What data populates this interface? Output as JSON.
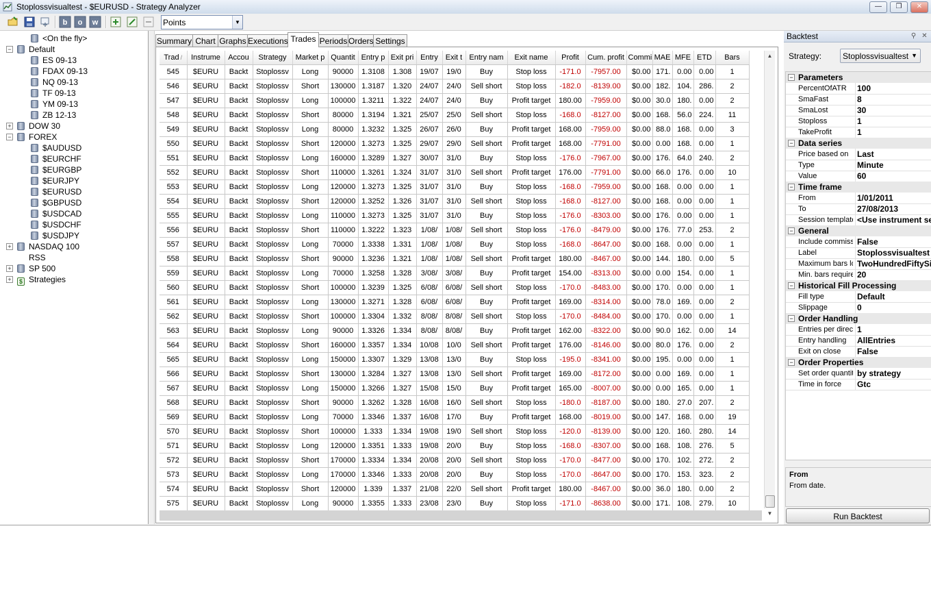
{
  "window": {
    "title": "Stoplossvisualtest - $EURUSD - Strategy Analyzer",
    "buttons": {
      "minimize": "—",
      "maximize": "❐",
      "close": "✕"
    }
  },
  "toolbar": {
    "display_unit": "Points",
    "icons": [
      "open-icon",
      "save-icon",
      "remove-icon",
      "bars-b-icon",
      "bars-o-icon",
      "bars-w-icon",
      "add-icon",
      "edit-icon",
      "minus-icon"
    ]
  },
  "tree": {
    "items": [
      {
        "label": "<On the fly>",
        "level": 1,
        "expander": ""
      },
      {
        "label": "Default",
        "level": 0,
        "expander": "−"
      },
      {
        "label": "ES 09-13",
        "level": 1,
        "expander": ""
      },
      {
        "label": "FDAX 09-13",
        "level": 1,
        "expander": ""
      },
      {
        "label": "NQ 09-13",
        "level": 1,
        "expander": ""
      },
      {
        "label": "TF 09-13",
        "level": 1,
        "expander": ""
      },
      {
        "label": "YM 09-13",
        "level": 1,
        "expander": ""
      },
      {
        "label": "ZB 12-13",
        "level": 1,
        "expander": ""
      },
      {
        "label": "DOW 30",
        "level": 0,
        "expander": "+"
      },
      {
        "label": "FOREX",
        "level": 0,
        "expander": "−"
      },
      {
        "label": "$AUDUSD",
        "level": 1,
        "expander": ""
      },
      {
        "label": "$EURCHF",
        "level": 1,
        "expander": ""
      },
      {
        "label": "$EURGBP",
        "level": 1,
        "expander": ""
      },
      {
        "label": "$EURJPY",
        "level": 1,
        "expander": ""
      },
      {
        "label": "$EURUSD",
        "level": 1,
        "expander": ""
      },
      {
        "label": "$GBPUSD",
        "level": 1,
        "expander": ""
      },
      {
        "label": "$USDCAD",
        "level": 1,
        "expander": ""
      },
      {
        "label": "$USDCHF",
        "level": 1,
        "expander": ""
      },
      {
        "label": "$USDJPY",
        "level": 1,
        "expander": ""
      },
      {
        "label": "NASDAQ 100",
        "level": 0,
        "expander": "+"
      },
      {
        "label": "RSS",
        "level": 0,
        "expander": ""
      },
      {
        "label": "SP 500",
        "level": 0,
        "expander": "+"
      },
      {
        "label": "Strategies",
        "level": 0,
        "expander": "+"
      }
    ]
  },
  "tabs": [
    "Summary",
    "Chart",
    "Graphs",
    "Executions",
    "Trades",
    "Periods",
    "Orders",
    "Settings"
  ],
  "active_tab": "Trades",
  "table": {
    "columns": [
      "Trad",
      "Instrume",
      "Accou",
      "Strategy",
      "Market p",
      "Quantit",
      "Entry p",
      "Exit pri",
      "Entry",
      "Exit t",
      "Entry nam",
      "Exit name",
      "Profit",
      "Cum. profit",
      "Commi",
      "MAE",
      "MFE",
      "ETD",
      "Bars"
    ],
    "sort_indicator": "/",
    "rows": [
      [
        "545",
        "$EURU",
        "Backt",
        "Stoplossv",
        "Long",
        "90000",
        "1.3108",
        "1.308",
        "19/07",
        "19/0",
        "Buy",
        "Stop loss",
        "-171.0",
        "-7957.00",
        "$0.00",
        "171.",
        "0.00",
        "0.00",
        "1"
      ],
      [
        "546",
        "$EURU",
        "Backt",
        "Stoplossv",
        "Short",
        "130000",
        "1.3187",
        "1.320",
        "24/07",
        "24/0",
        "Sell short",
        "Stop loss",
        "-182.0",
        "-8139.00",
        "$0.00",
        "182.",
        "104.",
        "286.",
        "2"
      ],
      [
        "547",
        "$EURU",
        "Backt",
        "Stoplossv",
        "Long",
        "100000",
        "1.3211",
        "1.322",
        "24/07",
        "24/0",
        "Buy",
        "Profit target",
        "180.00",
        "-7959.00",
        "$0.00",
        "30.0",
        "180.",
        "0.00",
        "2"
      ],
      [
        "548",
        "$EURU",
        "Backt",
        "Stoplossv",
        "Short",
        "80000",
        "1.3194",
        "1.321",
        "25/07",
        "25/0",
        "Sell short",
        "Stop loss",
        "-168.0",
        "-8127.00",
        "$0.00",
        "168.",
        "56.0",
        "224.",
        "11"
      ],
      [
        "549",
        "$EURU",
        "Backt",
        "Stoplossv",
        "Long",
        "80000",
        "1.3232",
        "1.325",
        "26/07",
        "26/0",
        "Buy",
        "Profit target",
        "168.00",
        "-7959.00",
        "$0.00",
        "88.0",
        "168.",
        "0.00",
        "3"
      ],
      [
        "550",
        "$EURU",
        "Backt",
        "Stoplossv",
        "Short",
        "120000",
        "1.3273",
        "1.325",
        "29/07",
        "29/0",
        "Sell short",
        "Profit target",
        "168.00",
        "-7791.00",
        "$0.00",
        "0.00",
        "168.",
        "0.00",
        "1"
      ],
      [
        "551",
        "$EURU",
        "Backt",
        "Stoplossv",
        "Long",
        "160000",
        "1.3289",
        "1.327",
        "30/07",
        "31/0",
        "Buy",
        "Stop loss",
        "-176.0",
        "-7967.00",
        "$0.00",
        "176.",
        "64.0",
        "240.",
        "2"
      ],
      [
        "552",
        "$EURU",
        "Backt",
        "Stoplossv",
        "Short",
        "110000",
        "1.3261",
        "1.324",
        "31/07",
        "31/0",
        "Sell short",
        "Profit target",
        "176.00",
        "-7791.00",
        "$0.00",
        "66.0",
        "176.",
        "0.00",
        "10"
      ],
      [
        "553",
        "$EURU",
        "Backt",
        "Stoplossv",
        "Long",
        "120000",
        "1.3273",
        "1.325",
        "31/07",
        "31/0",
        "Buy",
        "Stop loss",
        "-168.0",
        "-7959.00",
        "$0.00",
        "168.",
        "0.00",
        "0.00",
        "1"
      ],
      [
        "554",
        "$EURU",
        "Backt",
        "Stoplossv",
        "Short",
        "120000",
        "1.3252",
        "1.326",
        "31/07",
        "31/0",
        "Sell short",
        "Stop loss",
        "-168.0",
        "-8127.00",
        "$0.00",
        "168.",
        "0.00",
        "0.00",
        "1"
      ],
      [
        "555",
        "$EURU",
        "Backt",
        "Stoplossv",
        "Long",
        "110000",
        "1.3273",
        "1.325",
        "31/07",
        "31/0",
        "Buy",
        "Stop loss",
        "-176.0",
        "-8303.00",
        "$0.00",
        "176.",
        "0.00",
        "0.00",
        "1"
      ],
      [
        "556",
        "$EURU",
        "Backt",
        "Stoplossv",
        "Short",
        "110000",
        "1.3222",
        "1.323",
        "1/08/",
        "1/08/",
        "Sell short",
        "Stop loss",
        "-176.0",
        "-8479.00",
        "$0.00",
        "176.",
        "77.0",
        "253.",
        "2"
      ],
      [
        "557",
        "$EURU",
        "Backt",
        "Stoplossv",
        "Long",
        "70000",
        "1.3338",
        "1.331",
        "1/08/",
        "1/08/",
        "Buy",
        "Stop loss",
        "-168.0",
        "-8647.00",
        "$0.00",
        "168.",
        "0.00",
        "0.00",
        "1"
      ],
      [
        "558",
        "$EURU",
        "Backt",
        "Stoplossv",
        "Short",
        "90000",
        "1.3236",
        "1.321",
        "1/08/",
        "1/08/",
        "Sell short",
        "Profit target",
        "180.00",
        "-8467.00",
        "$0.00",
        "144.",
        "180.",
        "0.00",
        "5"
      ],
      [
        "559",
        "$EURU",
        "Backt",
        "Stoplossv",
        "Long",
        "70000",
        "1.3258",
        "1.328",
        "3/08/",
        "3/08/",
        "Buy",
        "Profit target",
        "154.00",
        "-8313.00",
        "$0.00",
        "0.00",
        "154.",
        "0.00",
        "1"
      ],
      [
        "560",
        "$EURU",
        "Backt",
        "Stoplossv",
        "Short",
        "100000",
        "1.3239",
        "1.325",
        "6/08/",
        "6/08/",
        "Sell short",
        "Stop loss",
        "-170.0",
        "-8483.00",
        "$0.00",
        "170.",
        "0.00",
        "0.00",
        "1"
      ],
      [
        "561",
        "$EURU",
        "Backt",
        "Stoplossv",
        "Long",
        "130000",
        "1.3271",
        "1.328",
        "6/08/",
        "6/08/",
        "Buy",
        "Profit target",
        "169.00",
        "-8314.00",
        "$0.00",
        "78.0",
        "169.",
        "0.00",
        "2"
      ],
      [
        "562",
        "$EURU",
        "Backt",
        "Stoplossv",
        "Short",
        "100000",
        "1.3304",
        "1.332",
        "8/08/",
        "8/08/",
        "Sell short",
        "Stop loss",
        "-170.0",
        "-8484.00",
        "$0.00",
        "170.",
        "0.00",
        "0.00",
        "1"
      ],
      [
        "563",
        "$EURU",
        "Backt",
        "Stoplossv",
        "Long",
        "90000",
        "1.3326",
        "1.334",
        "8/08/",
        "8/08/",
        "Buy",
        "Profit target",
        "162.00",
        "-8322.00",
        "$0.00",
        "90.0",
        "162.",
        "0.00",
        "14"
      ],
      [
        "564",
        "$EURU",
        "Backt",
        "Stoplossv",
        "Short",
        "160000",
        "1.3357",
        "1.334",
        "10/08",
        "10/0",
        "Sell short",
        "Profit target",
        "176.00",
        "-8146.00",
        "$0.00",
        "80.0",
        "176.",
        "0.00",
        "2"
      ],
      [
        "565",
        "$EURU",
        "Backt",
        "Stoplossv",
        "Long",
        "150000",
        "1.3307",
        "1.329",
        "13/08",
        "13/0",
        "Buy",
        "Stop loss",
        "-195.0",
        "-8341.00",
        "$0.00",
        "195.",
        "0.00",
        "0.00",
        "1"
      ],
      [
        "566",
        "$EURU",
        "Backt",
        "Stoplossv",
        "Short",
        "130000",
        "1.3284",
        "1.327",
        "13/08",
        "13/0",
        "Sell short",
        "Profit target",
        "169.00",
        "-8172.00",
        "$0.00",
        "0.00",
        "169.",
        "0.00",
        "1"
      ],
      [
        "567",
        "$EURU",
        "Backt",
        "Stoplossv",
        "Long",
        "150000",
        "1.3266",
        "1.327",
        "15/08",
        "15/0",
        "Buy",
        "Profit target",
        "165.00",
        "-8007.00",
        "$0.00",
        "0.00",
        "165.",
        "0.00",
        "1"
      ],
      [
        "568",
        "$EURU",
        "Backt",
        "Stoplossv",
        "Short",
        "90000",
        "1.3262",
        "1.328",
        "16/08",
        "16/0",
        "Sell short",
        "Stop loss",
        "-180.0",
        "-8187.00",
        "$0.00",
        "180.",
        "27.0",
        "207.",
        "2"
      ],
      [
        "569",
        "$EURU",
        "Backt",
        "Stoplossv",
        "Long",
        "70000",
        "1.3346",
        "1.337",
        "16/08",
        "17/0",
        "Buy",
        "Profit target",
        "168.00",
        "-8019.00",
        "$0.00",
        "147.",
        "168.",
        "0.00",
        "19"
      ],
      [
        "570",
        "$EURU",
        "Backt",
        "Stoplossv",
        "Short",
        "100000",
        "1.333",
        "1.334",
        "19/08",
        "19/0",
        "Sell short",
        "Stop loss",
        "-120.0",
        "-8139.00",
        "$0.00",
        "120.",
        "160.",
        "280.",
        "14"
      ],
      [
        "571",
        "$EURU",
        "Backt",
        "Stoplossv",
        "Long",
        "120000",
        "1.3351",
        "1.333",
        "19/08",
        "20/0",
        "Buy",
        "Stop loss",
        "-168.0",
        "-8307.00",
        "$0.00",
        "168.",
        "108.",
        "276.",
        "5"
      ],
      [
        "572",
        "$EURU",
        "Backt",
        "Stoplossv",
        "Short",
        "170000",
        "1.3334",
        "1.334",
        "20/08",
        "20/0",
        "Sell short",
        "Stop loss",
        "-170.0",
        "-8477.00",
        "$0.00",
        "170.",
        "102.",
        "272.",
        "2"
      ],
      [
        "573",
        "$EURU",
        "Backt",
        "Stoplossv",
        "Long",
        "170000",
        "1.3346",
        "1.333",
        "20/08",
        "20/0",
        "Buy",
        "Stop loss",
        "-170.0",
        "-8647.00",
        "$0.00",
        "170.",
        "153.",
        "323.",
        "2"
      ],
      [
        "574",
        "$EURU",
        "Backt",
        "Stoplossv",
        "Short",
        "120000",
        "1.339",
        "1.337",
        "21/08",
        "22/0",
        "Sell short",
        "Profit target",
        "180.00",
        "-8467.00",
        "$0.00",
        "36.0",
        "180.",
        "0.00",
        "2"
      ],
      [
        "575",
        "$EURU",
        "Backt",
        "Stoplossv",
        "Long",
        "90000",
        "1.3355",
        "1.333",
        "23/08",
        "23/0",
        "Buy",
        "Stop loss",
        "-171.0",
        "-8638.00",
        "$0.00",
        "171.",
        "108.",
        "279.",
        "10"
      ]
    ]
  },
  "backtest_panel": {
    "title": "Backtest",
    "strategy_label": "Strategy:",
    "strategy_value": "Stoplossvisualtest",
    "categories": [
      {
        "name": "Parameters",
        "props": [
          [
            "PercentOfATR",
            "100"
          ],
          [
            "SmaFast",
            "8"
          ],
          [
            "SmaLost",
            "30"
          ],
          [
            "Stoploss",
            "1"
          ],
          [
            "TakeProfit",
            "1"
          ]
        ]
      },
      {
        "name": "Data series",
        "props": [
          [
            "Price based on",
            "Last"
          ],
          [
            "Type",
            "Minute"
          ],
          [
            "Value",
            "60"
          ]
        ]
      },
      {
        "name": "Time frame",
        "props": [
          [
            "From",
            "1/01/2011"
          ],
          [
            "To",
            "27/08/2013"
          ],
          [
            "Session template",
            "<Use instrument set"
          ]
        ]
      },
      {
        "name": "General",
        "props": [
          [
            "Include commiss",
            "False"
          ],
          [
            "Label",
            "Stoplossvisualtest"
          ],
          [
            "Maximum bars lo",
            "TwoHundredFiftySix"
          ],
          [
            "Min. bars require",
            "20"
          ]
        ]
      },
      {
        "name": "Historical Fill Processing",
        "props": [
          [
            "Fill type",
            "Default"
          ],
          [
            "Slippage",
            "0"
          ]
        ]
      },
      {
        "name": "Order Handling",
        "props": [
          [
            "Entries per direct",
            "1"
          ],
          [
            "Entry handling",
            "AllEntries"
          ],
          [
            "Exit on close",
            "False"
          ]
        ]
      },
      {
        "name": "Order Properties",
        "props": [
          [
            "Set order quantit",
            "by strategy"
          ],
          [
            "Time in force",
            "Gtc"
          ]
        ]
      }
    ],
    "description_title": "From",
    "description_text": "From date.",
    "run_button": "Run Backtest"
  },
  "colors": {
    "negative": "#c00000",
    "title_gradient_top": "#eef3fa"
  }
}
